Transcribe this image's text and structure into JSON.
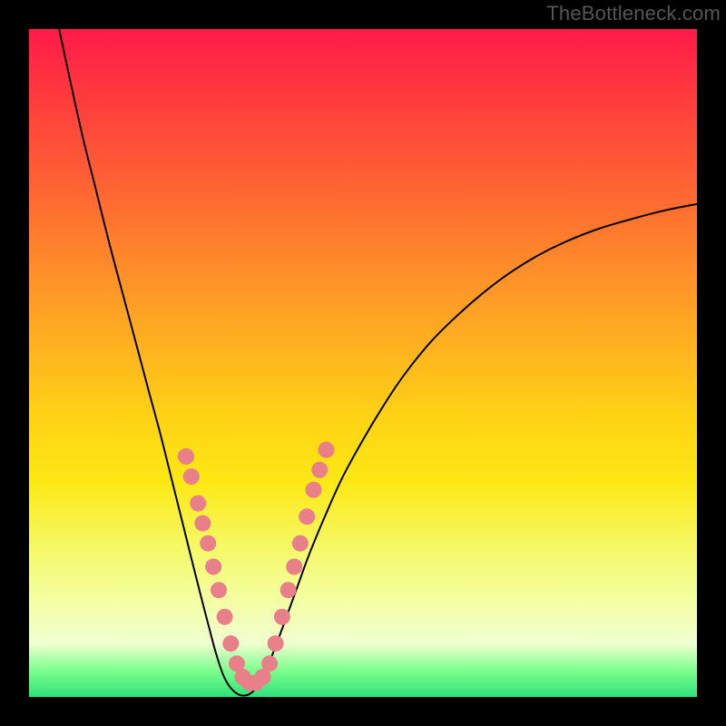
{
  "watermark": "TheBottleneck.com",
  "chart_data": {
    "type": "line",
    "title": "",
    "xlabel": "",
    "ylabel": "",
    "xlim": [
      0,
      100
    ],
    "ylim": [
      0,
      100
    ],
    "background_gradient": [
      "#ff1a4a",
      "#ffd214",
      "#2de27a"
    ],
    "curve_points": [
      {
        "x": 4.5,
        "y": 100.0
      },
      {
        "x": 6.0,
        "y": 93.0
      },
      {
        "x": 8.0,
        "y": 84.0
      },
      {
        "x": 10.0,
        "y": 76.0
      },
      {
        "x": 12.0,
        "y": 68.0
      },
      {
        "x": 14.0,
        "y": 60.5
      },
      {
        "x": 16.0,
        "y": 53.0
      },
      {
        "x": 18.0,
        "y": 45.5
      },
      {
        "x": 19.5,
        "y": 40.0
      },
      {
        "x": 21.0,
        "y": 34.0
      },
      {
        "x": 22.5,
        "y": 28.0
      },
      {
        "x": 24.0,
        "y": 22.0
      },
      {
        "x": 25.5,
        "y": 16.0
      },
      {
        "x": 26.8,
        "y": 11.0
      },
      {
        "x": 28.0,
        "y": 6.5
      },
      {
        "x": 29.2,
        "y": 3.0
      },
      {
        "x": 30.5,
        "y": 1.0
      },
      {
        "x": 32.0,
        "y": 0.2
      },
      {
        "x": 33.5,
        "y": 0.8
      },
      {
        "x": 35.0,
        "y": 3.0
      },
      {
        "x": 36.5,
        "y": 6.5
      },
      {
        "x": 38.0,
        "y": 10.5
      },
      {
        "x": 40.0,
        "y": 16.0
      },
      {
        "x": 42.0,
        "y": 21.5
      },
      {
        "x": 44.5,
        "y": 27.5
      },
      {
        "x": 47.0,
        "y": 33.0
      },
      {
        "x": 50.0,
        "y": 38.5
      },
      {
        "x": 53.0,
        "y": 43.5
      },
      {
        "x": 56.0,
        "y": 48.0
      },
      {
        "x": 60.0,
        "y": 53.0
      },
      {
        "x": 64.0,
        "y": 57.0
      },
      {
        "x": 68.0,
        "y": 60.5
      },
      {
        "x": 72.0,
        "y": 63.5
      },
      {
        "x": 76.0,
        "y": 66.0
      },
      {
        "x": 80.0,
        "y": 68.0
      },
      {
        "x": 85.0,
        "y": 70.0
      },
      {
        "x": 90.0,
        "y": 71.5
      },
      {
        "x": 95.0,
        "y": 72.8
      },
      {
        "x": 100.0,
        "y": 73.8
      }
    ],
    "marker_points": [
      {
        "x": 23.5,
        "y": 36.0
      },
      {
        "x": 24.3,
        "y": 33.0
      },
      {
        "x": 25.3,
        "y": 29.0
      },
      {
        "x": 26.0,
        "y": 26.0
      },
      {
        "x": 26.8,
        "y": 23.0
      },
      {
        "x": 27.6,
        "y": 19.5
      },
      {
        "x": 28.4,
        "y": 16.0
      },
      {
        "x": 29.3,
        "y": 12.0
      },
      {
        "x": 30.2,
        "y": 8.0
      },
      {
        "x": 31.1,
        "y": 5.0
      },
      {
        "x": 32.0,
        "y": 3.0
      },
      {
        "x": 33.0,
        "y": 2.1
      },
      {
        "x": 34.0,
        "y": 2.1
      },
      {
        "x": 35.0,
        "y": 3.0
      },
      {
        "x": 36.0,
        "y": 5.0
      },
      {
        "x": 36.9,
        "y": 8.0
      },
      {
        "x": 37.9,
        "y": 12.0
      },
      {
        "x": 38.8,
        "y": 16.0
      },
      {
        "x": 39.7,
        "y": 19.5
      },
      {
        "x": 40.6,
        "y": 23.0
      },
      {
        "x": 41.6,
        "y": 27.0
      },
      {
        "x": 42.6,
        "y": 31.0
      },
      {
        "x": 43.5,
        "y": 34.0
      },
      {
        "x": 44.5,
        "y": 37.0
      }
    ],
    "marker_radius": 9
  }
}
